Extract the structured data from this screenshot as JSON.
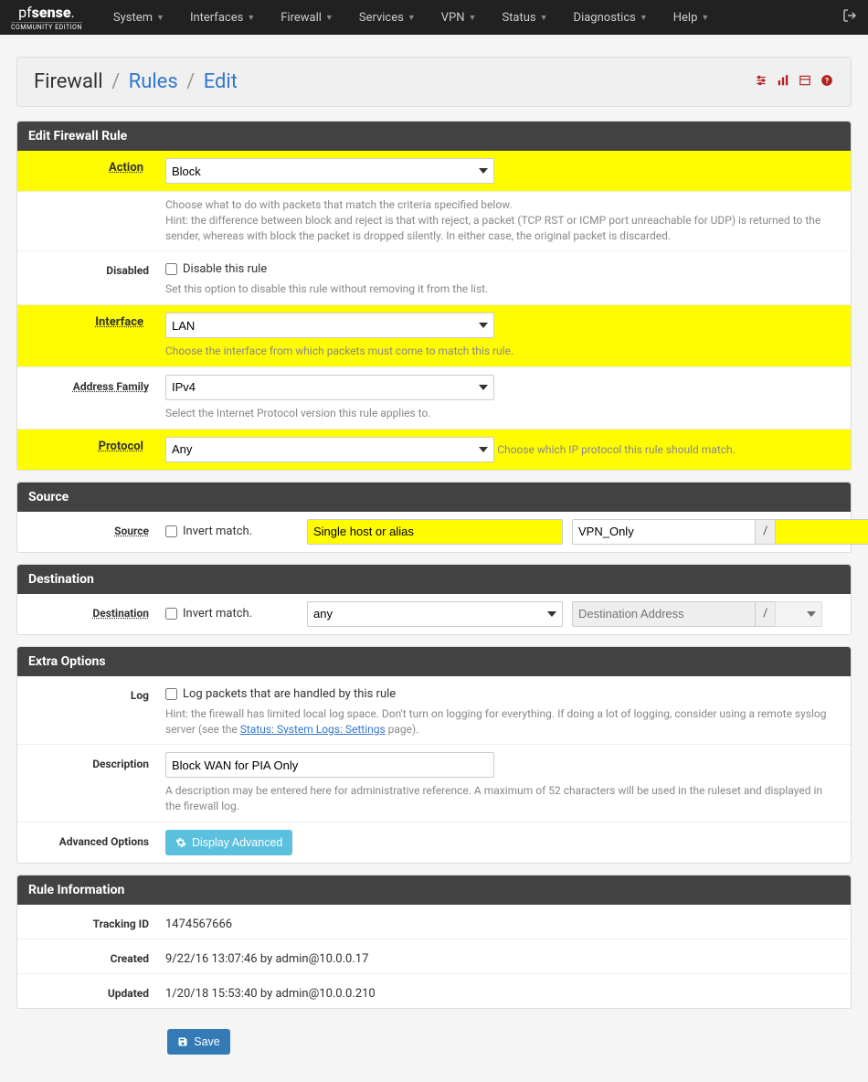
{
  "brand": {
    "main_white": "pf",
    "main_bold": "sense",
    "sub": "COMMUNITY EDITION"
  },
  "nav": [
    "System",
    "Interfaces",
    "Firewall",
    "Services",
    "VPN",
    "Status",
    "Diagnostics",
    "Help"
  ],
  "breadcrumb": {
    "root": "Firewall",
    "mid": "Rules",
    "leaf": "Edit"
  },
  "panels": {
    "edit": {
      "title": "Edit Firewall Rule",
      "action": {
        "label": "Action",
        "value": "Block",
        "hint1": "Choose what to do with packets that match the criteria specified below.",
        "hint2": "Hint: the difference between block and reject is that with reject, a packet (TCP RST or ICMP port unreachable for UDP) is returned to the sender, whereas with block the packet is dropped silently. In either case, the original packet is discarded."
      },
      "disabled": {
        "label": "Disabled",
        "check": "Disable this rule",
        "hint": "Set this option to disable this rule without removing it from the list."
      },
      "interface": {
        "label": "Interface",
        "value": "LAN",
        "hint": "Choose the interface from which packets must come to match this rule."
      },
      "address_family": {
        "label": "Address Family",
        "value": "IPv4",
        "hint": "Select the Internet Protocol version this rule applies to."
      },
      "protocol": {
        "label": "Protocol",
        "value": "Any",
        "hint": "Choose which IP protocol this rule should match."
      }
    },
    "source": {
      "title": "Source",
      "label": "Source",
      "invert": "Invert match.",
      "type": "Single host or alias",
      "value": "VPN_Only",
      "addon": "/",
      "mask": ""
    },
    "destination": {
      "title": "Destination",
      "label": "Destination",
      "invert": "Invert match.",
      "type": "any",
      "placeholder": "Destination Address",
      "addon": "/",
      "mask": ""
    },
    "extra": {
      "title": "Extra Options",
      "log": {
        "label": "Log",
        "check": "Log packets that are handled by this rule",
        "hint_pre": "Hint: the firewall has limited local log space. Don't turn on logging for everything. If doing a lot of logging, consider using a remote syslog server (see the ",
        "hint_link": "Status: System Logs: Settings",
        "hint_post": " page)."
      },
      "description": {
        "label": "Description",
        "value": "Block WAN for PIA Only",
        "hint": "A description may be entered here for administrative reference. A maximum of 52 characters will be used in the ruleset and displayed in the firewall log."
      },
      "advanced": {
        "label": "Advanced Options",
        "button": "Display Advanced"
      }
    },
    "info": {
      "title": "Rule Information",
      "tracking": {
        "label": "Tracking ID",
        "value": "1474567666"
      },
      "created": {
        "label": "Created",
        "value": "9/22/16 13:07:46 by admin@10.0.0.17"
      },
      "updated": {
        "label": "Updated",
        "value": "1/20/18 15:53:40 by admin@10.0.0.210"
      }
    }
  },
  "save": "Save"
}
